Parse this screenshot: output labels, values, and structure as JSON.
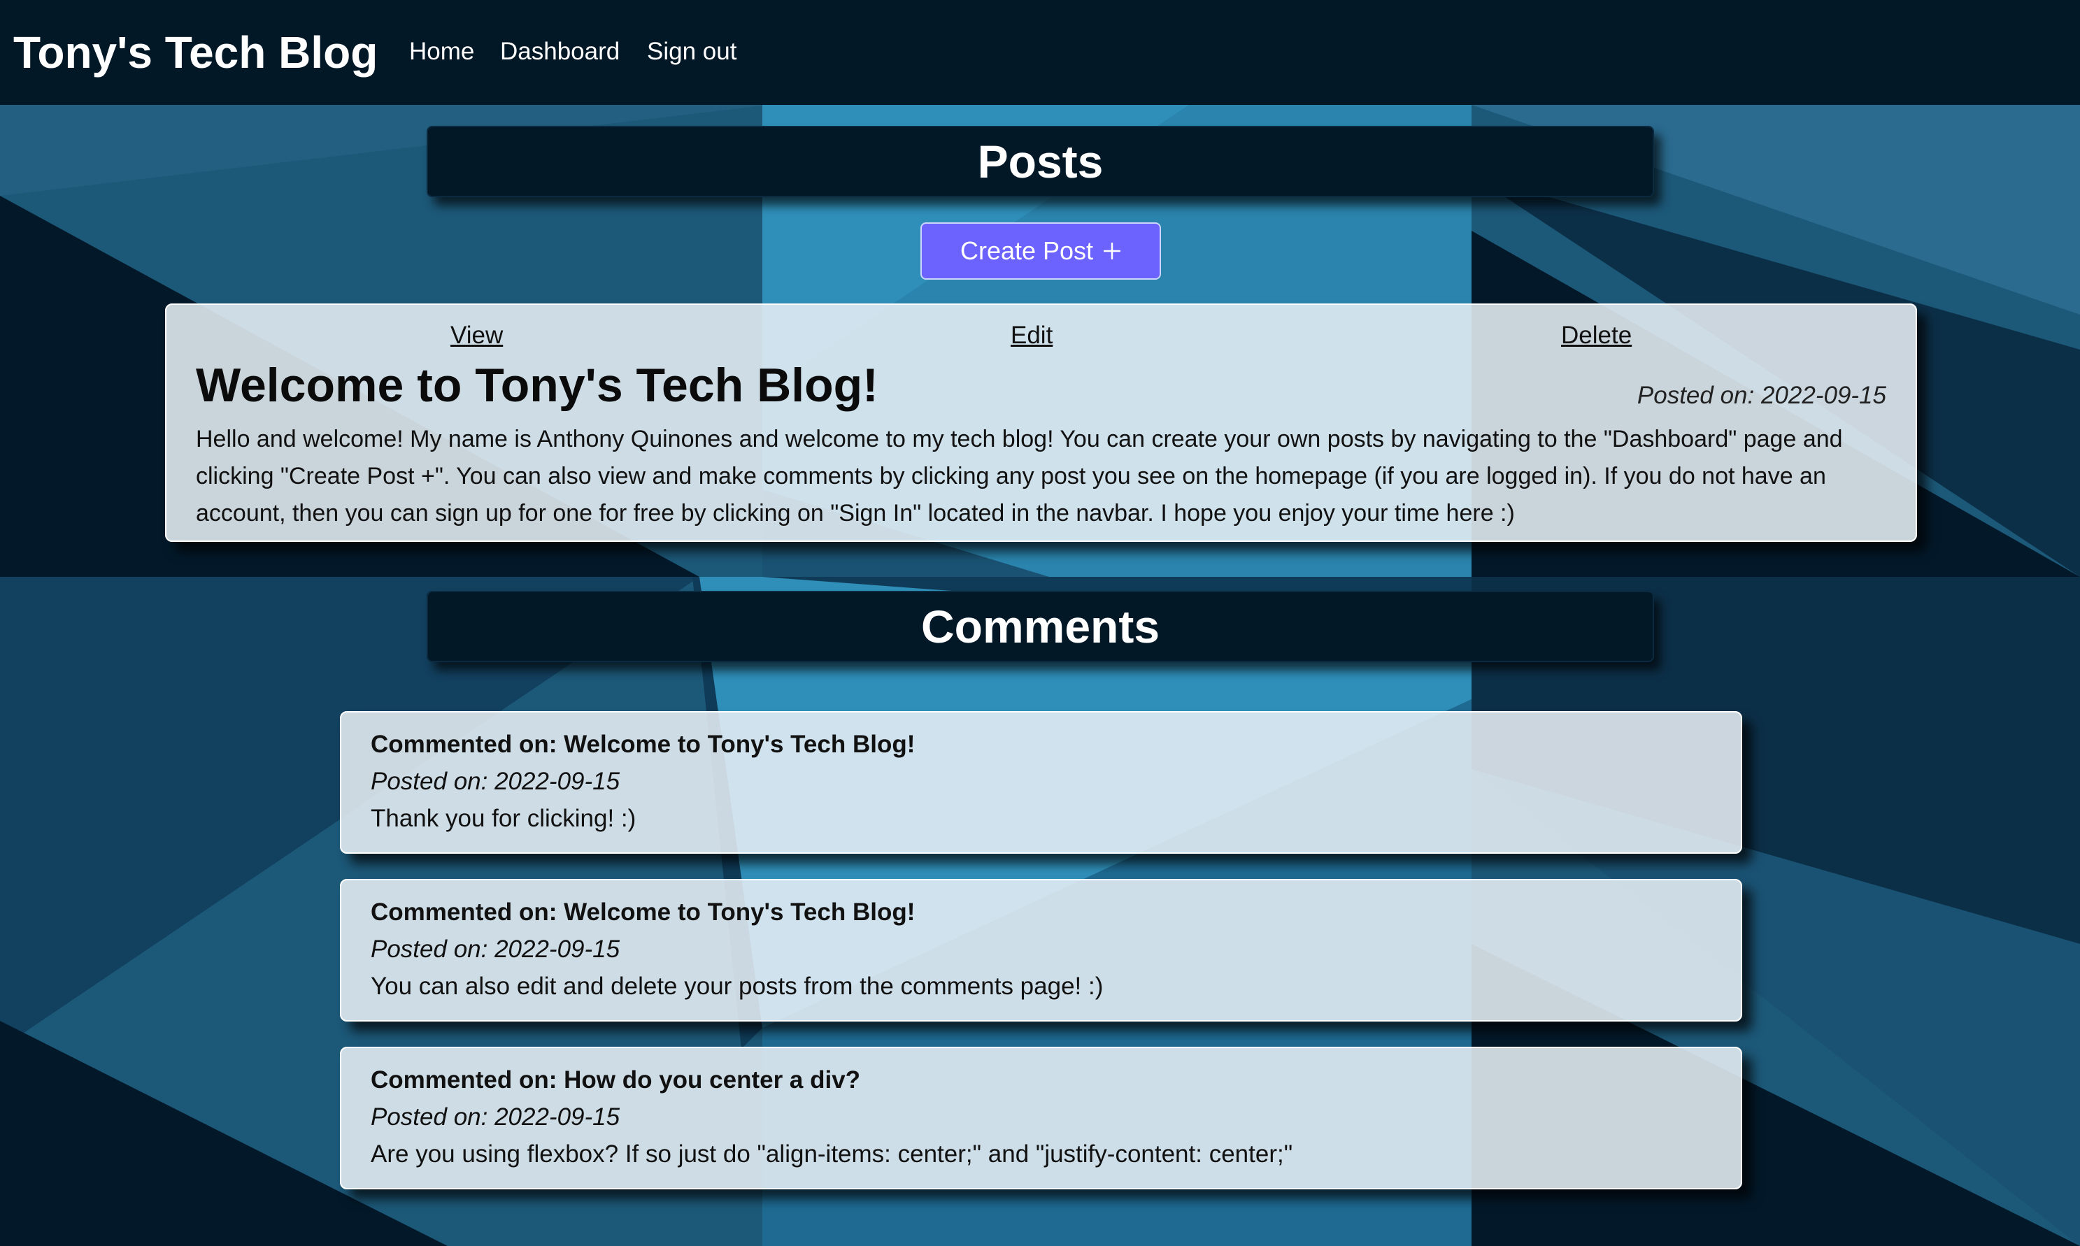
{
  "navbar": {
    "brand": "Tony's Tech Blog",
    "links": [
      {
        "label": "Home"
      },
      {
        "label": "Dashboard"
      },
      {
        "label": "Sign out"
      }
    ]
  },
  "posts_section": {
    "title": "Posts",
    "create_button_label": "Create Post",
    "create_button_icon": "plus-icon",
    "accent_color": "#6c63ff"
  },
  "post": {
    "actions": {
      "view": "View",
      "edit": "Edit",
      "delete": "Delete"
    },
    "title": "Welcome to Tony's Tech Blog!",
    "posted_on": "Posted on: 2022-09-15",
    "body": "Hello and welcome! My name is Anthony Quinones and welcome to my tech blog! You can create your own posts by navigating to the \"Dashboard\" page and clicking \"Create Post +\". You can also view and make comments by clicking any post you see on the homepage (if you are logged in). If you do not have an account, then you can sign up for one for free by clicking on \"Sign In\" located in the navbar. I hope you enjoy your time here :)"
  },
  "comments_section": {
    "title": "Comments",
    "comments": [
      {
        "heading": "Commented on: Welcome to Tony's Tech Blog!",
        "posted_on": "Posted on: 2022-09-15",
        "text": "Thank you for clicking! :)"
      },
      {
        "heading": "Commented on: Welcome to Tony's Tech Blog!",
        "posted_on": "Posted on: 2022-09-15",
        "text": "You can also edit and delete your posts from the comments page! :)"
      },
      {
        "heading": "Commented on: How do you center a div?",
        "posted_on": "Posted on: 2022-09-15",
        "text": "Are you using flexbox? If so just do \"align-items: center;\" and \"justify-content: center;\""
      }
    ]
  },
  "colors": {
    "navbar": "#021827",
    "background_dark": "#03192a",
    "background_mid": "#1c5878",
    "background_light": "#2a84ad",
    "card": "#e6eef4"
  }
}
